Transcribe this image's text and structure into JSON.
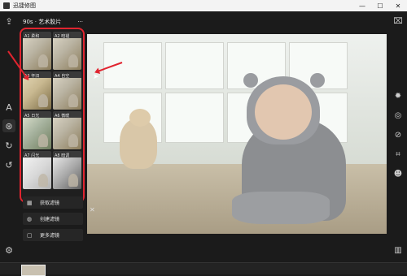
{
  "window": {
    "title": "迅捷修图",
    "min_glyph": "—",
    "max_glyph": "☐",
    "close_glyph": "✕"
  },
  "panel": {
    "title": "90s · 艺术胶片",
    "more_glyph": "···",
    "filters": [
      {
        "label": "A1 柔和"
      },
      {
        "label": "A2 暗褪"
      },
      {
        "label": "A3 怀旧"
      },
      {
        "label": "A4 自空"
      },
      {
        "label": "A5 日光"
      },
      {
        "label": "A6 微暖"
      },
      {
        "label": "A7 闪光"
      },
      {
        "label": "A8 暗调"
      }
    ],
    "actions": [
      {
        "label": "获取滤镜",
        "icon": "grid-icon"
      },
      {
        "label": "创建滤镜",
        "icon": "palette-icon"
      },
      {
        "label": "更多滤镜",
        "icon": "bag-icon"
      }
    ]
  },
  "left_tools": [
    {
      "icon": "export-icon"
    },
    {
      "icon": "text-icon"
    },
    {
      "icon": "filter-icon",
      "active": true
    },
    {
      "icon": "adjust-icon"
    },
    {
      "icon": "undo-icon"
    },
    {
      "icon": "settings-icon"
    }
  ],
  "right_tools": [
    {
      "icon": "camera-icon"
    },
    {
      "icon": "gear-icon"
    },
    {
      "icon": "lens-icon"
    },
    {
      "icon": "eraser-icon"
    },
    {
      "icon": "crop-icon"
    },
    {
      "icon": "face-icon"
    },
    {
      "icon": "compare-icon"
    }
  ],
  "colors": {
    "highlight": "#e0242f"
  }
}
